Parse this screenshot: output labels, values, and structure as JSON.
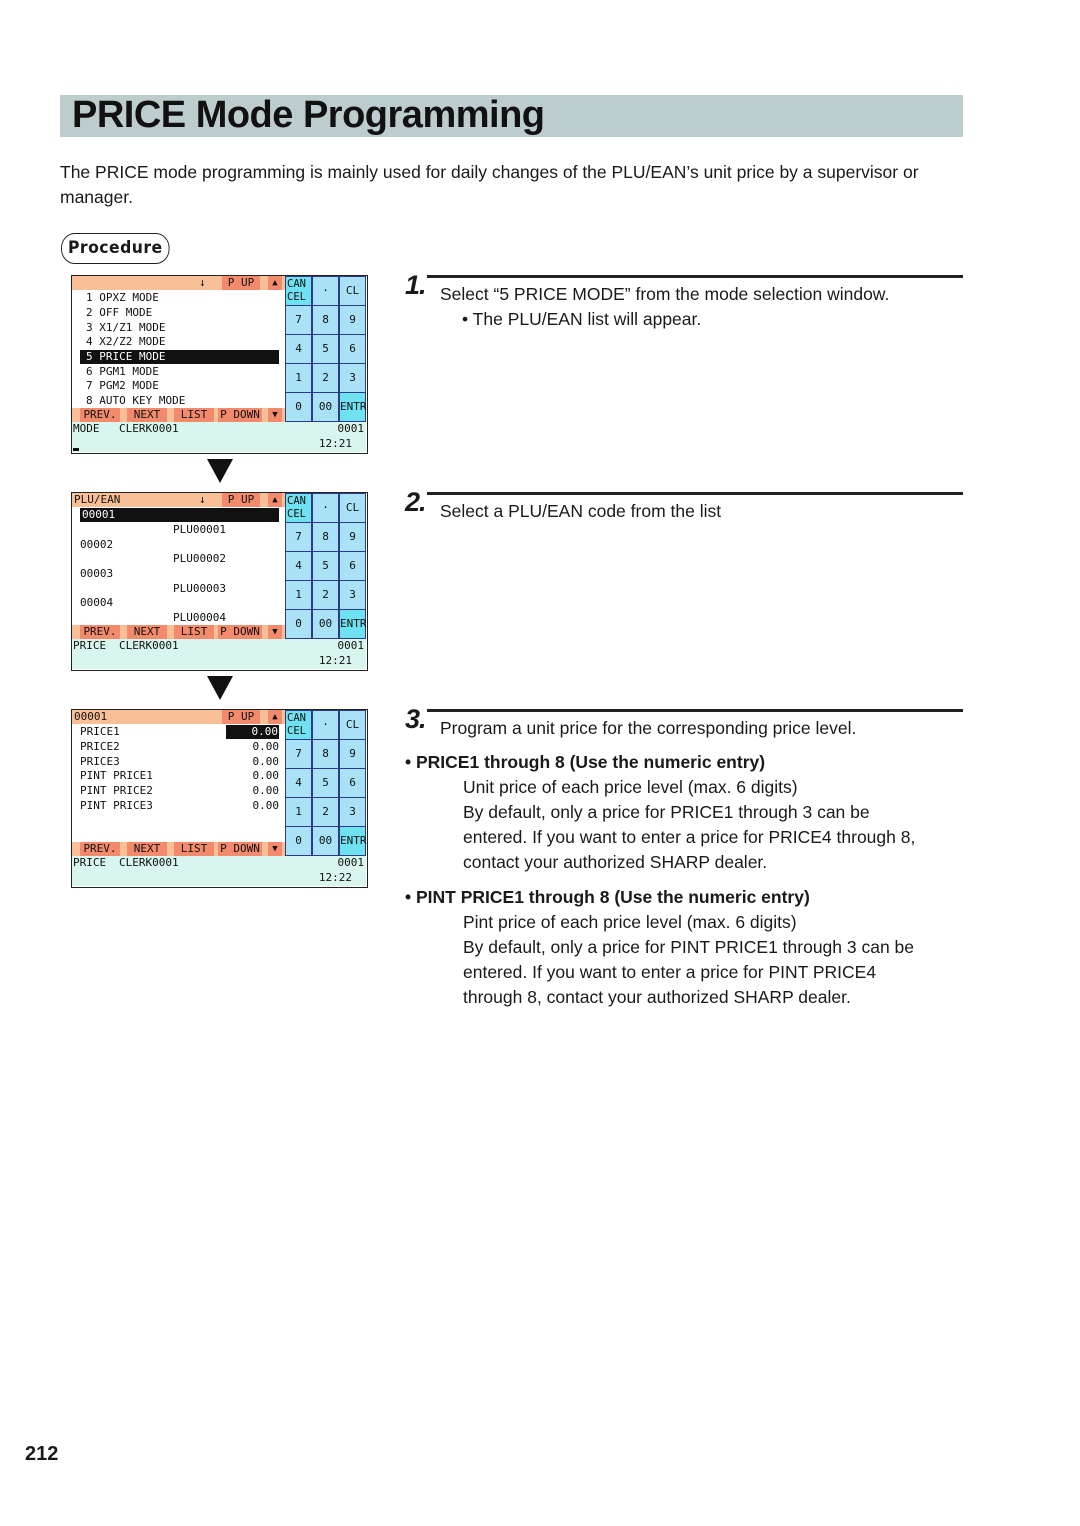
{
  "page": {
    "title": "PRICE Mode Programming",
    "intro": "The PRICE mode programming is mainly used for daily changes of the PLU/EAN’s unit price by a supervisor or manager.",
    "procedure_label": "Procedure",
    "page_number": "212",
    "colors": {
      "title_band": "#bdcccc",
      "screen_header": "#f9c097",
      "screen_button": "#f48a6c",
      "key": "#a9e2f6",
      "key_highlight": "#6fe2f2",
      "status_bar": "#d8f6ee",
      "keypad_border": "#2b3a8a"
    }
  },
  "keypad": {
    "keys": [
      "CAN\nCEL",
      "·",
      "CL",
      "7",
      "8",
      "9",
      "4",
      "5",
      "6",
      "1",
      "2",
      "3",
      "0",
      "00",
      "ENTR"
    ]
  },
  "screens": [
    {
      "header_label": "",
      "down_arrow": "↓",
      "page_up": "P UP",
      "up_arrow": "▲",
      "rows": [
        {
          "text": "1 OPXZ MODE",
          "selected": false
        },
        {
          "text": "2 OFF MODE",
          "selected": false
        },
        {
          "text": "3 X1/Z1 MODE",
          "selected": false
        },
        {
          "text": "4 X2/Z2 MODE",
          "selected": false
        },
        {
          "text": "5 PRICE MODE",
          "selected": true
        },
        {
          "text": "6 PGM1 MODE",
          "selected": false
        },
        {
          "text": "7 PGM2 MODE",
          "selected": false
        },
        {
          "text": "8 AUTO KEY MODE",
          "selected": false
        }
      ],
      "buttons": [
        "PREV.",
        "NEXT",
        "LIST",
        "P DOWN",
        "▼"
      ],
      "status_mode": "MODE",
      "status_clerk": "CLERK0001",
      "status_number": "0001",
      "status_time": "12:21"
    },
    {
      "header_label": "PLU/EAN",
      "down_arrow": "↓",
      "page_up": "P UP",
      "up_arrow": "▲",
      "rows": [
        {
          "code": "00001",
          "name": "PLU00001",
          "selected": true
        },
        {
          "code": "00002",
          "name": "PLU00002",
          "selected": false
        },
        {
          "code": "00003",
          "name": "PLU00003",
          "selected": false
        },
        {
          "code": "00004",
          "name": "PLU00004",
          "selected": false
        }
      ],
      "buttons": [
        "PREV.",
        "NEXT",
        "LIST",
        "P DOWN",
        "▼"
      ],
      "status_mode": "PRICE",
      "status_clerk": "CLERK0001",
      "status_number": "0001",
      "status_time": "12:21"
    },
    {
      "header_label": "00001",
      "page_up": "P UP",
      "up_arrow": "▲",
      "rows": [
        {
          "label": "PRICE1",
          "value": "0.00",
          "selected": true
        },
        {
          "label": "PRICE2",
          "value": "0.00",
          "selected": false
        },
        {
          "label": "PRICE3",
          "value": "0.00",
          "selected": false
        },
        {
          "label": "PINT PRICE1",
          "value": "0.00",
          "selected": false
        },
        {
          "label": "PINT PRICE2",
          "value": "0.00",
          "selected": false
        },
        {
          "label": "PINT PRICE3",
          "value": "0.00",
          "selected": false
        }
      ],
      "buttons": [
        "PREV.",
        "NEXT",
        "LIST",
        "P DOWN",
        "▼"
      ],
      "status_mode": "PRICE",
      "status_clerk": "CLERK0001",
      "status_number": "0001",
      "status_time": "12:22"
    }
  ],
  "steps": [
    {
      "number": "1.",
      "text": "Select “5 PRICE MODE” from the mode selection window.",
      "note": "• The PLU/EAN list will appear."
    },
    {
      "number": "2.",
      "text": "Select a PLU/EAN code from the list"
    },
    {
      "number": "3.",
      "text": "Program a unit price for the corresponding price level."
    }
  ],
  "bullets": [
    {
      "heading": "• PRICE1 through 8 (Use the numeric entry)",
      "lines": [
        "Unit price of each price level (max. 6 digits)",
        "By default, only a price for PRICE1 through 3 can be",
        "entered. If you want to enter a price for PRICE4 through 8,",
        "contact your authorized SHARP dealer."
      ]
    },
    {
      "heading": "• PINT PRICE1 through 8 (Use the numeric entry)",
      "lines": [
        "Pint price of each price level (max. 6 digits)",
        "By default, only a price for PINT PRICE1 through 3 can be",
        "entered. If you want to enter a price for PINT PRICE4",
        "through 8, contact your authorized SHARP dealer."
      ]
    }
  ]
}
